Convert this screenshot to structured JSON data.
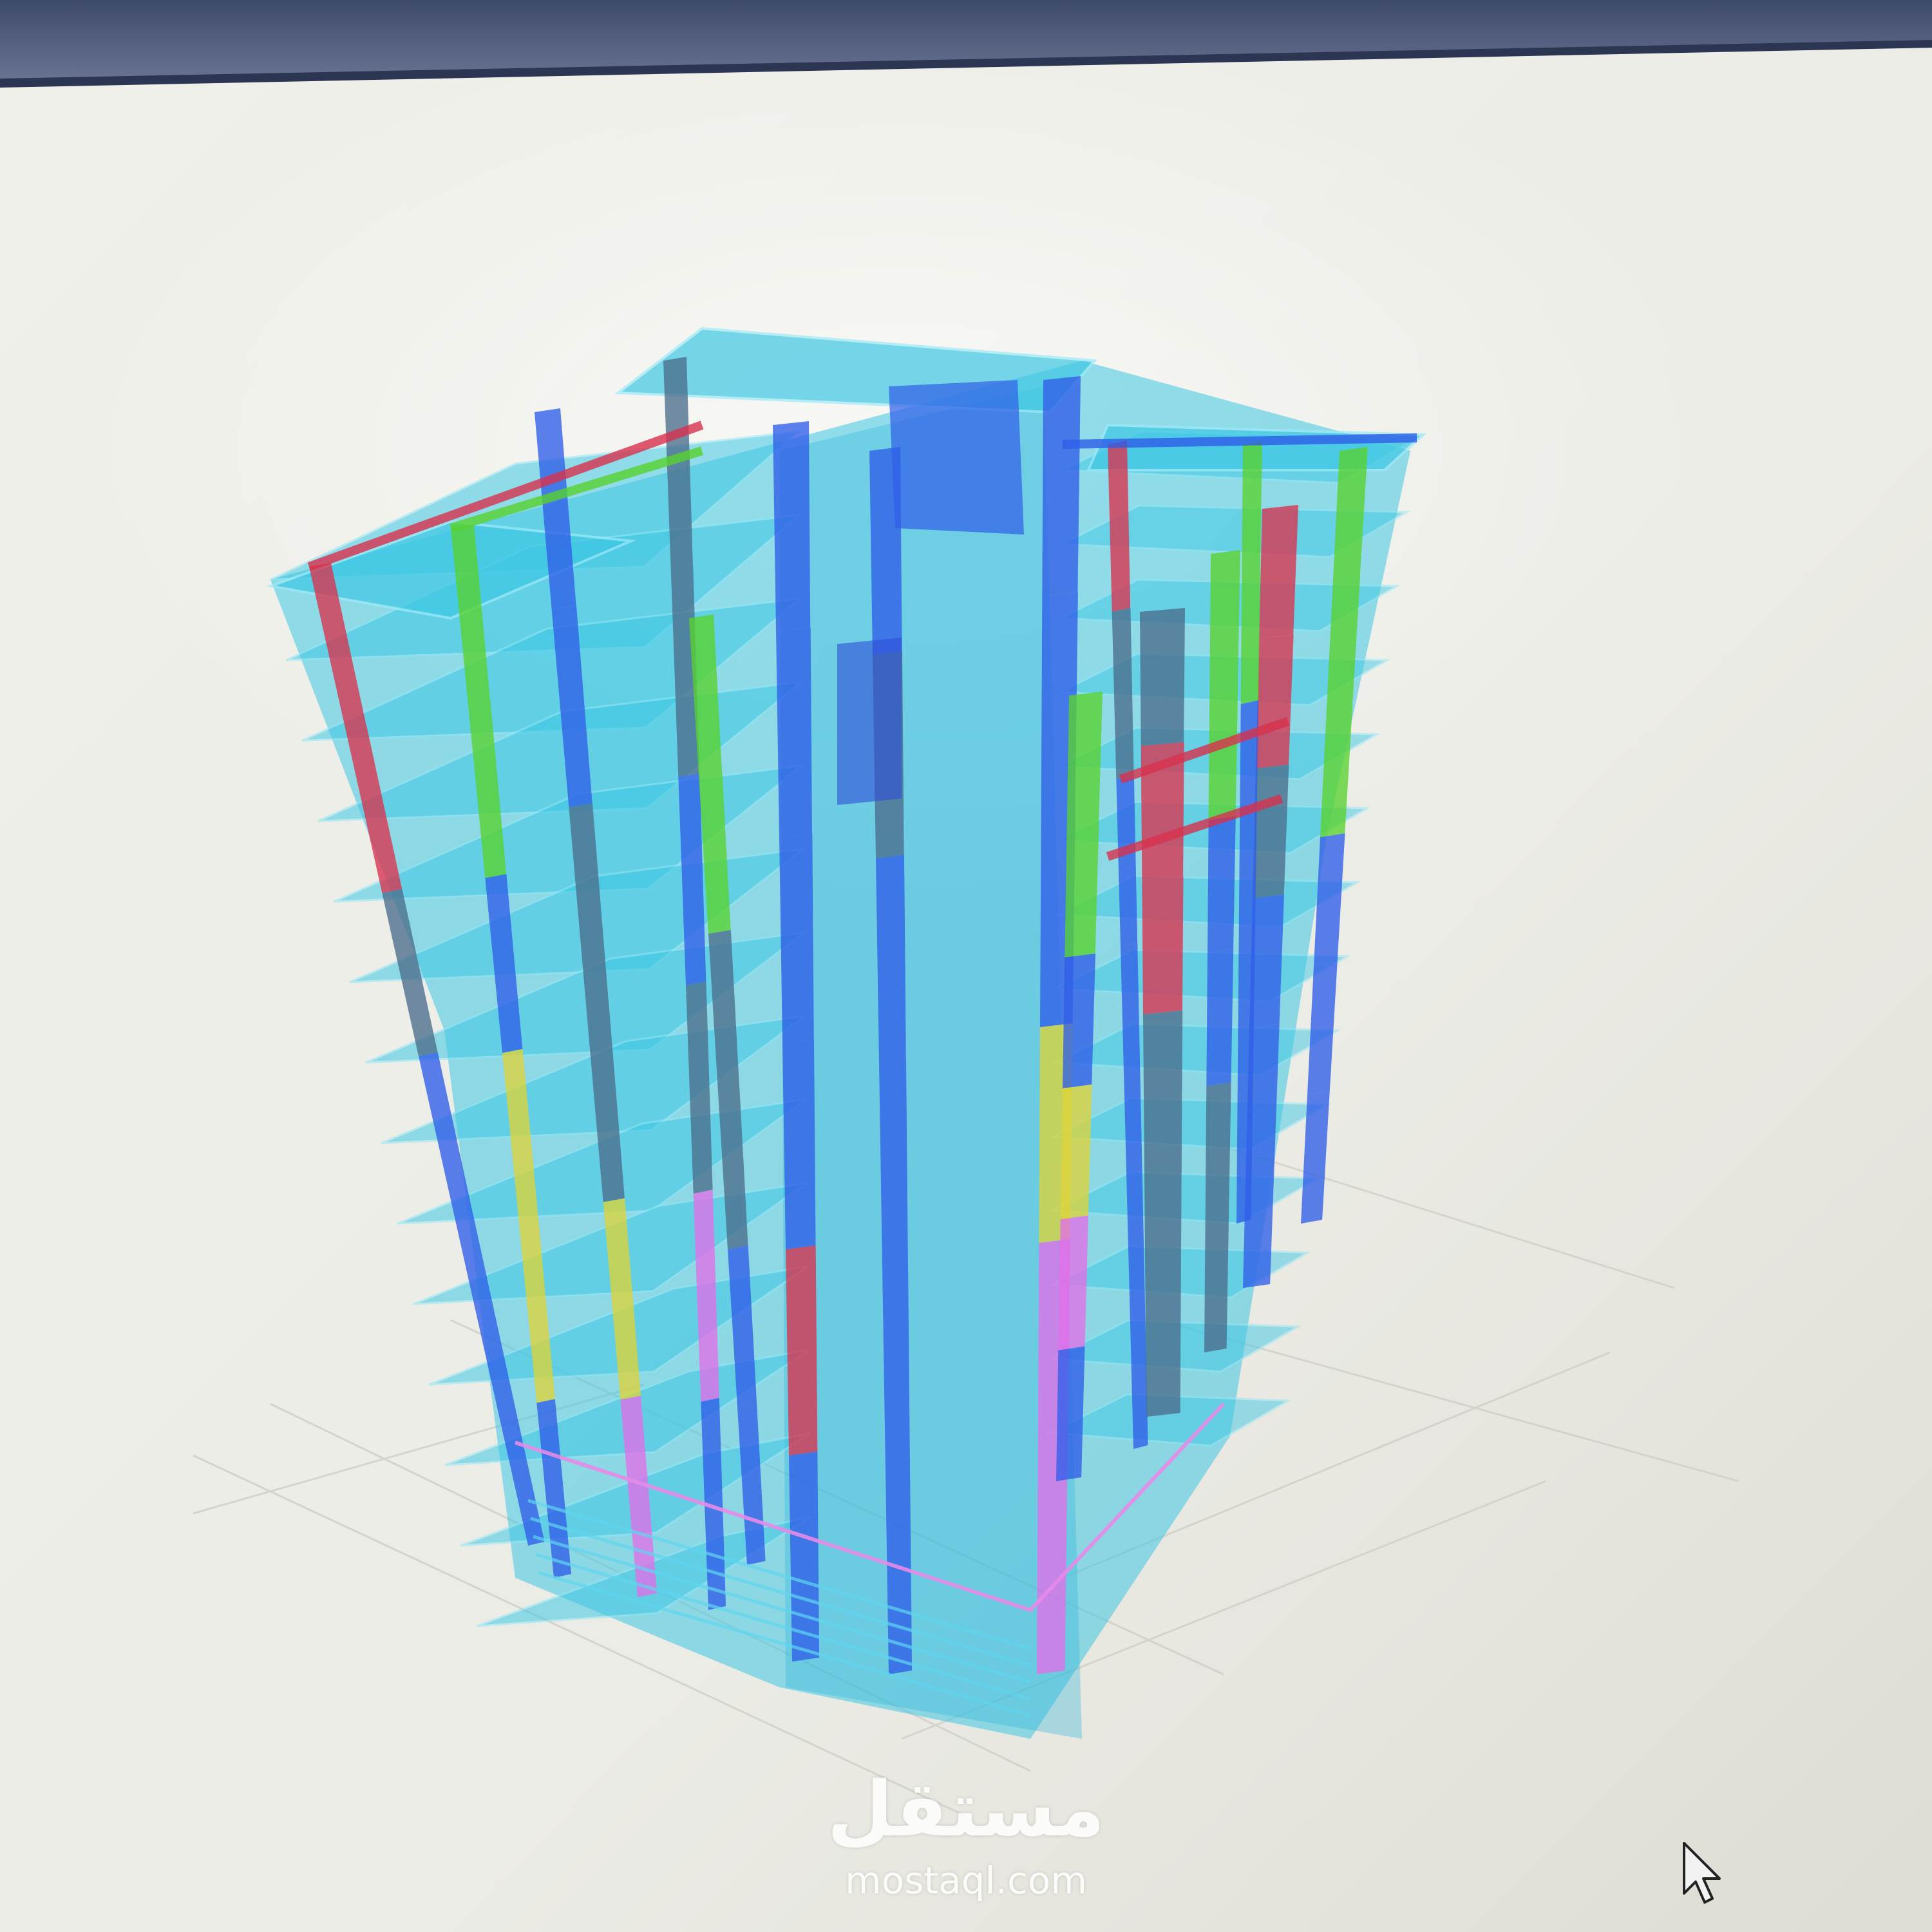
{
  "app": {
    "window_title": "",
    "view": "3D structural model view"
  },
  "viewport": {
    "background_color": "#ecece6",
    "title_bar_color": "#56607c"
  },
  "model": {
    "slab_color": "#3fc8e4",
    "member_colors": {
      "blue": "#2f5ee8",
      "green": "#58d22e",
      "red": "#d8324e",
      "yellow": "#dcd43a",
      "magenta": "#e070e8",
      "slate": "#4a6d8c"
    }
  },
  "cursor": {
    "icon": "mouse-pointer-icon"
  },
  "watermark": {
    "logo_text": "مستقل",
    "url_text": "mostaql.com"
  }
}
